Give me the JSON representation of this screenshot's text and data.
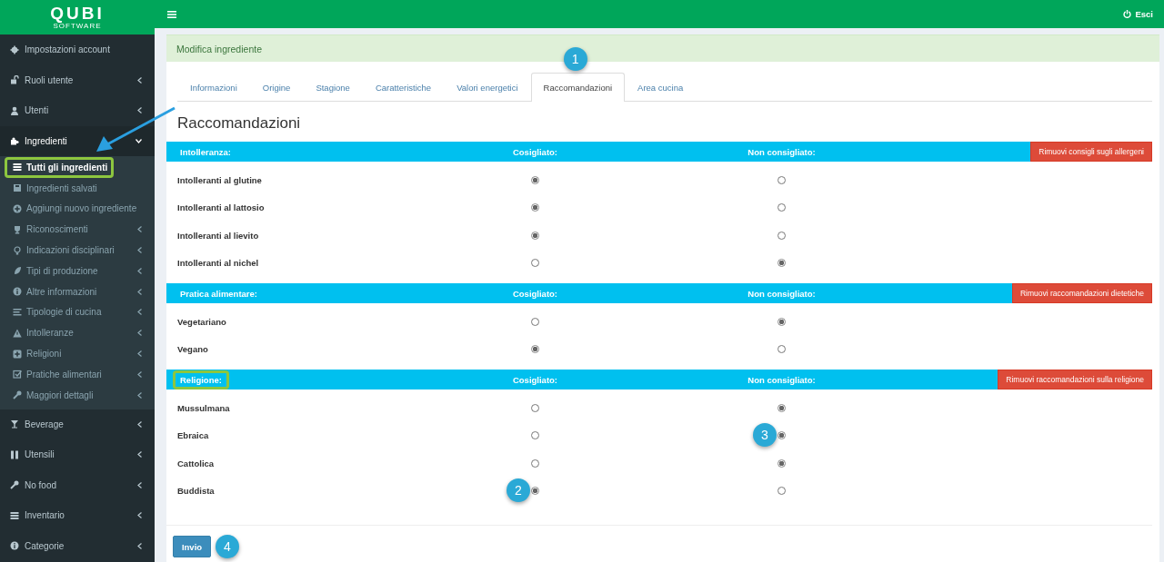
{
  "logo": {
    "name": "QUBI",
    "tagline": "SOFTWARE"
  },
  "header": {
    "logout": "Esci"
  },
  "sidebar": {
    "items": [
      {
        "label": "Impostazioni account",
        "submenu": false,
        "selected": false
      },
      {
        "label": "Ruoli utente",
        "submenu": true,
        "expanded": false,
        "selected": false
      },
      {
        "label": "Utenti",
        "submenu": true,
        "expanded": false,
        "selected": false
      },
      {
        "label": "Ingredienti",
        "submenu": true,
        "expanded": true,
        "selected": true,
        "children": [
          {
            "label": "Tutti gli ingredienti",
            "submenu": false,
            "selected": true,
            "highlighted": true
          },
          {
            "label": "Ingredienti salvati",
            "submenu": false,
            "selected": false,
            "highlighted": false
          },
          {
            "label": "Aggiungi nuovo ingrediente",
            "submenu": false,
            "selected": false,
            "highlighted": false
          },
          {
            "label": "Riconoscimenti",
            "submenu": true,
            "selected": false,
            "highlighted": false
          },
          {
            "label": "Indicazioni disciplinari",
            "submenu": true,
            "selected": false,
            "highlighted": false
          },
          {
            "label": "Tipi di produzione",
            "submenu": true,
            "selected": false,
            "highlighted": false
          },
          {
            "label": "Altre informazioni",
            "submenu": true,
            "selected": false,
            "highlighted": false
          },
          {
            "label": "Tipologie di cucina",
            "submenu": true,
            "selected": false,
            "highlighted": false
          },
          {
            "label": "Intolleranze",
            "submenu": true,
            "selected": false,
            "highlighted": false
          },
          {
            "label": "Religioni",
            "submenu": true,
            "selected": false,
            "highlighted": false
          },
          {
            "label": "Pratiche alimentari",
            "submenu": true,
            "selected": false,
            "highlighted": false
          },
          {
            "label": "Maggiori dettagli",
            "submenu": true,
            "selected": false,
            "highlighted": false
          }
        ]
      },
      {
        "label": "Beverage",
        "submenu": true,
        "expanded": false,
        "selected": false
      },
      {
        "label": "Utensili",
        "submenu": true,
        "expanded": false,
        "selected": false
      },
      {
        "label": "No food",
        "submenu": true,
        "expanded": false,
        "selected": false
      },
      {
        "label": "Inventario",
        "submenu": true,
        "expanded": false,
        "selected": false
      },
      {
        "label": "Categorie",
        "submenu": true,
        "expanded": false,
        "selected": false
      }
    ]
  },
  "panel": {
    "title": "Modifica ingrediente",
    "tabs": [
      {
        "label": "Informazioni",
        "selected": false
      },
      {
        "label": "Origine",
        "selected": false
      },
      {
        "label": "Stagione",
        "selected": false
      },
      {
        "label": "Caratteristiche",
        "selected": false
      },
      {
        "label": "Valori energetici",
        "selected": false
      },
      {
        "label": "Raccomandazioni",
        "selected": true,
        "callout": "1"
      },
      {
        "label": "Area cucina",
        "selected": false
      }
    ],
    "heading": "Raccomandazioni",
    "sections": [
      {
        "label": "Intolleranza:",
        "col_yes": "Cosigliato:",
        "col_no": "Non consigliato:",
        "remove_button": "Rimuovi consigli sugli allergeni",
        "highlighted": false,
        "rows": [
          {
            "label": "Intolleranti al glutine",
            "options": [
              {
                "selected": true
              },
              {
                "selected": false
              }
            ]
          },
          {
            "label": "Intolleranti al lattosio",
            "options": [
              {
                "selected": true
              },
              {
                "selected": false
              }
            ]
          },
          {
            "label": "Intolleranti al lievito",
            "options": [
              {
                "selected": true
              },
              {
                "selected": false
              }
            ]
          },
          {
            "label": "Intolleranti al nichel",
            "options": [
              {
                "selected": false
              },
              {
                "selected": true
              }
            ]
          }
        ]
      },
      {
        "label": "Pratica alimentare:",
        "col_yes": "Cosigliato:",
        "col_no": "Non consigliato:",
        "remove_button": "Rimuovi raccomandazioni dietetiche",
        "highlighted": false,
        "rows": [
          {
            "label": "Vegetariano",
            "options": [
              {
                "selected": false
              },
              {
                "selected": true
              }
            ]
          },
          {
            "label": "Vegano",
            "options": [
              {
                "selected": true
              },
              {
                "selected": false
              }
            ]
          }
        ]
      },
      {
        "label": "Religione:",
        "col_yes": "Cosigliato:",
        "col_no": "Non consigliato:",
        "remove_button": "Rimuovi raccomandazioni sulla religione",
        "highlighted": true,
        "rows": [
          {
            "label": "Mussulmana",
            "options": [
              {
                "selected": false
              },
              {
                "selected": true
              }
            ]
          },
          {
            "label": "Ebraica",
            "options": [
              {
                "selected": false
              },
              {
                "selected": true,
                "callout": "3"
              }
            ]
          },
          {
            "label": "Cattolica",
            "options": [
              {
                "selected": false
              },
              {
                "selected": true
              }
            ]
          },
          {
            "label": "Buddista",
            "options": [
              {
                "selected": true,
                "callout": "2"
              },
              {
                "selected": false
              }
            ]
          }
        ]
      }
    ],
    "submit": {
      "label": "Invio",
      "callout": "4"
    }
  }
}
